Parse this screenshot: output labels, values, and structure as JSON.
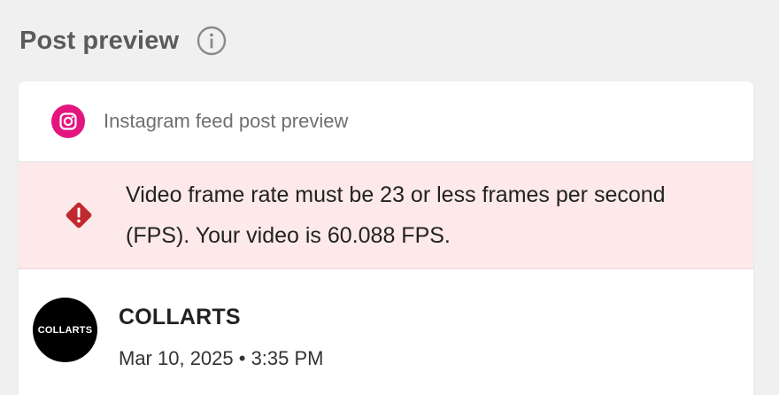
{
  "header": {
    "title": "Post preview",
    "info_icon": "info-icon"
  },
  "card": {
    "platform_icon": "instagram-icon",
    "platform_color": "#e4157f",
    "label": "Instagram feed post preview",
    "alert": {
      "icon": "warning-diamond-icon",
      "color": "#c0292f",
      "background": "#fde9ea",
      "message": "Video frame rate must be 23 or less frames per second (FPS). Your video is 60.088 FPS."
    },
    "post": {
      "avatar_text": "COLLARTS",
      "account_name": "COLLARTS",
      "date": "Mar 10, 2025 • 3:35 PM"
    }
  }
}
